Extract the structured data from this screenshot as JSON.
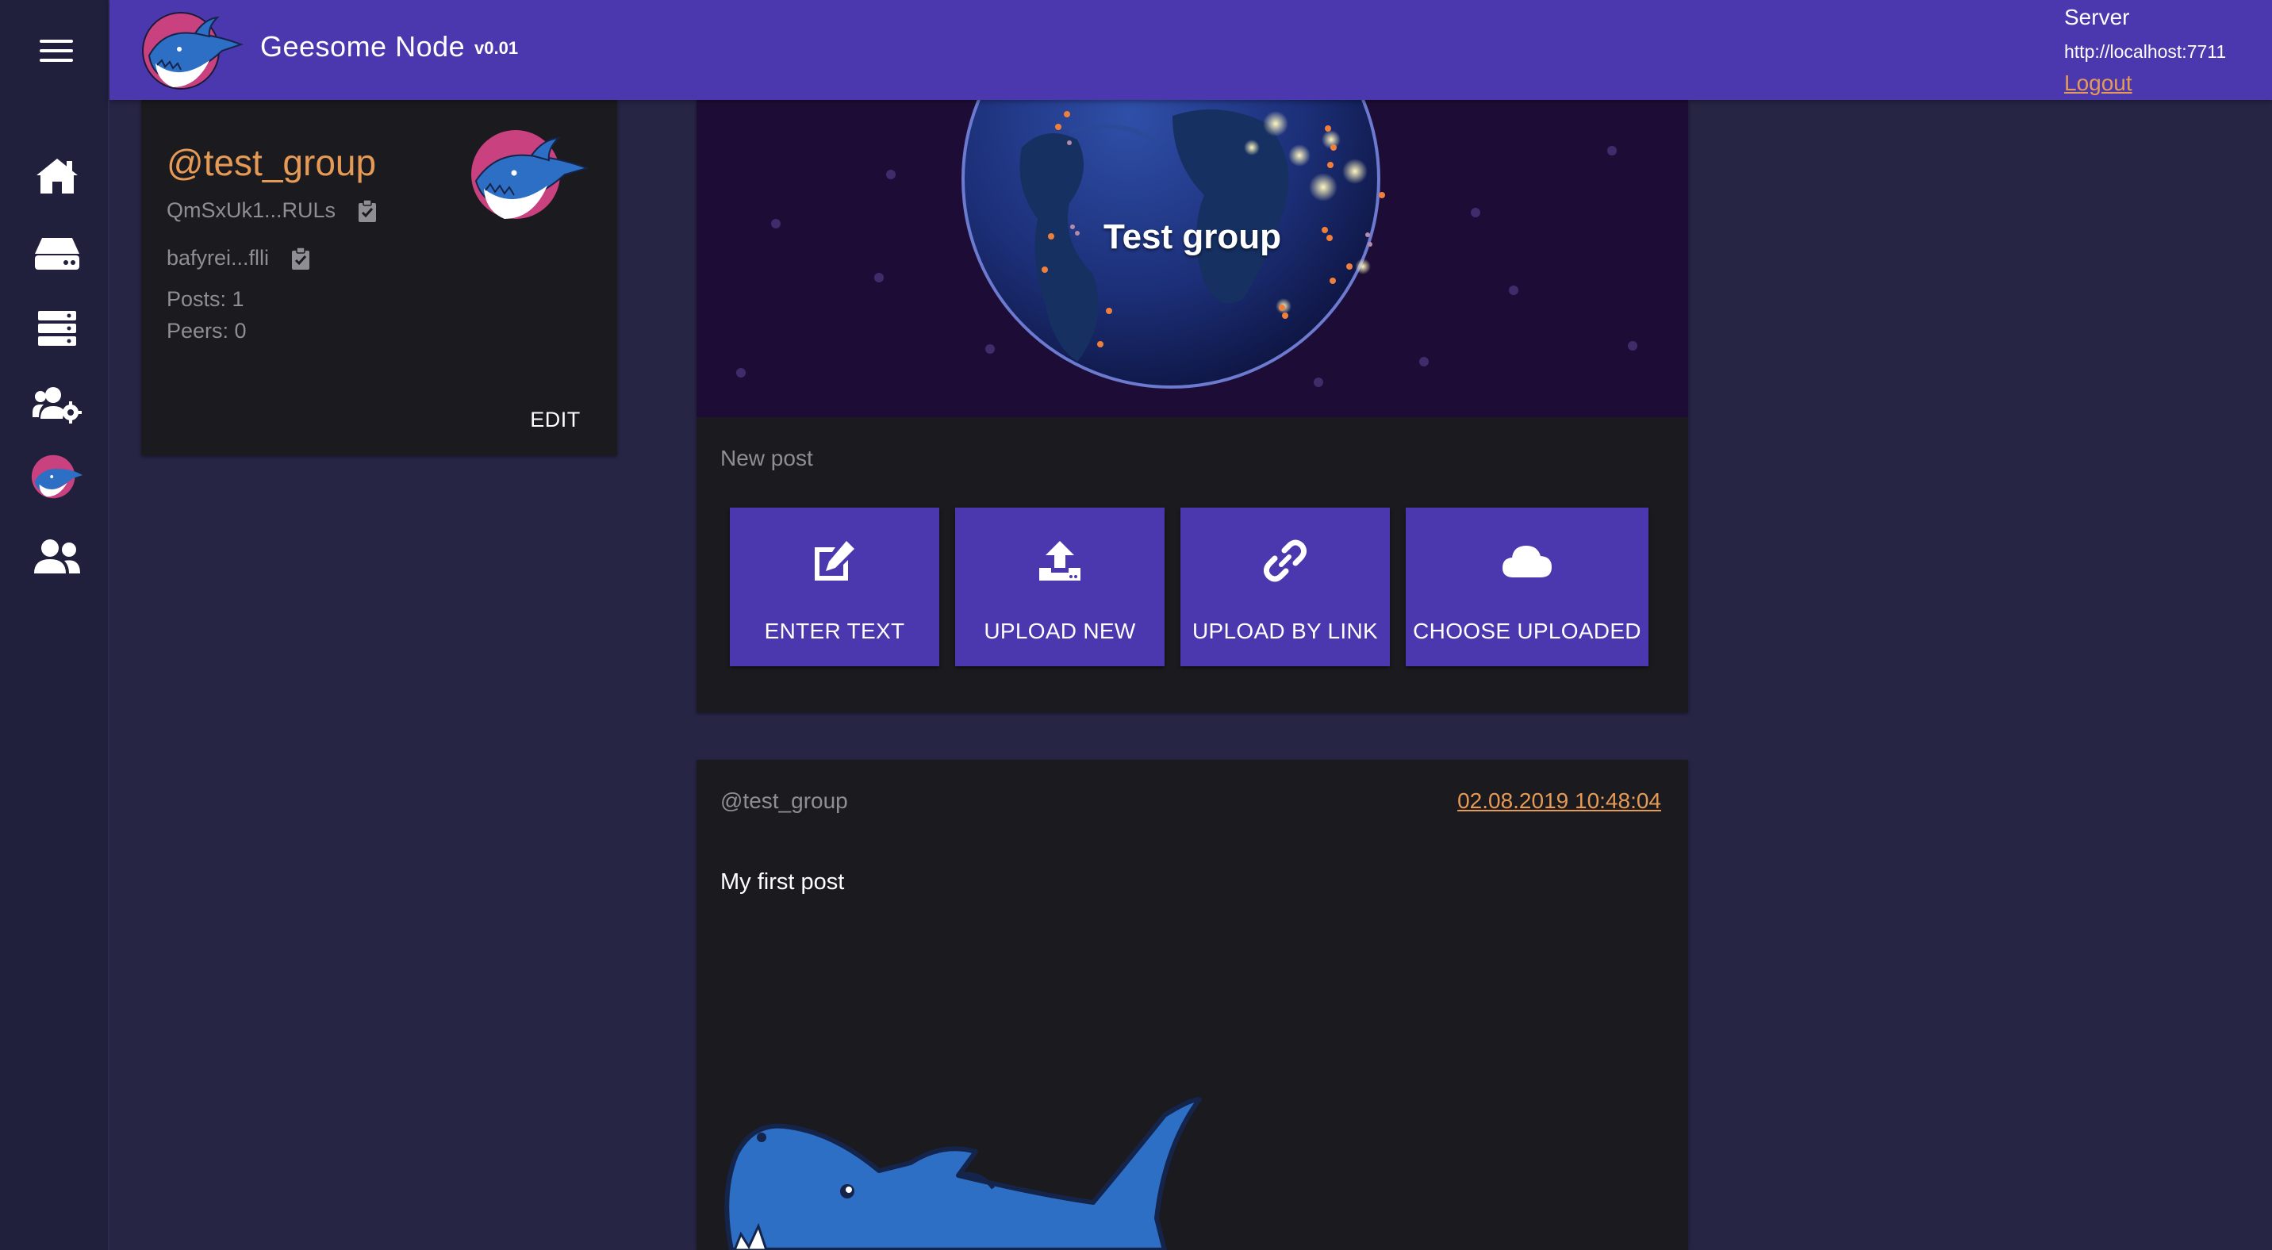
{
  "app": {
    "title": "Geesome Node",
    "version": "v0.01"
  },
  "server": {
    "label": "Server",
    "url": "http://localhost:7711",
    "logout": "Logout"
  },
  "sidebar": {
    "items": [
      {
        "name": "home",
        "icon": "home-icon"
      },
      {
        "name": "storage",
        "icon": "hdd-icon"
      },
      {
        "name": "servers",
        "icon": "server-icon"
      },
      {
        "name": "groups-settings",
        "icon": "users-cog-icon"
      },
      {
        "name": "test-group",
        "icon": "shark-avatar"
      },
      {
        "name": "friends",
        "icon": "users-icon"
      }
    ]
  },
  "profile": {
    "handle": "@test_group",
    "storage_id": "QmSxUk1...RULs",
    "static_id": "bafyrei...flli",
    "posts": "Posts: 1",
    "peers": "Peers: 0",
    "edit_label": "EDIT"
  },
  "group": {
    "title": "Test group",
    "new_post_label": "New post",
    "actions": [
      {
        "label": "ENTER TEXT",
        "icon": "edit-icon"
      },
      {
        "label": "UPLOAD NEW",
        "icon": "upload-icon"
      },
      {
        "label": "UPLOAD BY LINK",
        "icon": "link-icon"
      },
      {
        "label": "CHOOSE UPLOADED",
        "icon": "cloud-icon"
      }
    ]
  },
  "post": {
    "author": "@test_group",
    "date": "02.08.2019 10:48:04",
    "text": "My first post"
  },
  "colors": {
    "primary": "#4b38ae",
    "accent": "#e59a56",
    "background": "#262544",
    "card": "#1b1a1e",
    "muted": "#8f8e95"
  }
}
